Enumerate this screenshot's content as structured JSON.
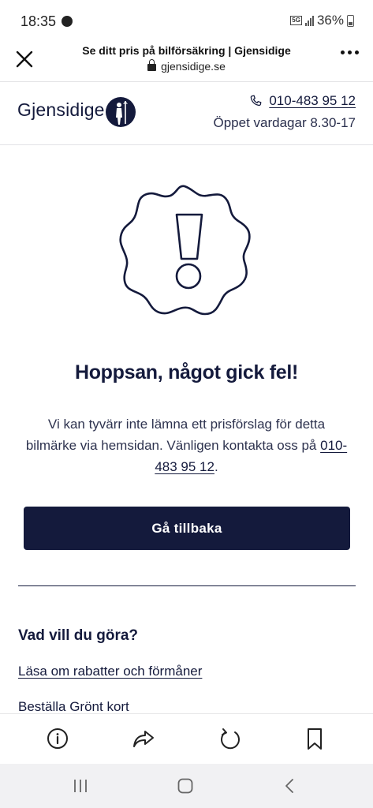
{
  "status": {
    "time": "18:35",
    "network": "5G",
    "battery": "36%"
  },
  "browser": {
    "page_title": "Se ditt pris på bilförsäkring | Gjensidige",
    "domain": "gjensidige.se"
  },
  "header": {
    "logo_text": "Gjensidige",
    "phone": "010-483 95 12",
    "hours": "Öppet vardagar 8.30-17"
  },
  "error": {
    "title": "Hoppsan, något gick fel!",
    "text_before": "Vi kan tyvärr inte lämna ett prisförslag för detta bilmärke via hemsidan. Vänligen kontakta oss på ",
    "phone": "010-483 95 12",
    "text_after": ".",
    "back_button": "Gå tillbaka"
  },
  "actions": {
    "heading": "Vad vill du göra?",
    "items": [
      "Läsa om rabatter och förmåner",
      "Beställa Grönt kort"
    ]
  },
  "toolbar": {
    "icons": [
      "info-icon",
      "share-icon",
      "refresh-icon",
      "bookmark-icon"
    ]
  },
  "colors": {
    "brand_navy": "#141a3c",
    "background": "#ffffff",
    "nav_bar": "#f1f1f3"
  }
}
